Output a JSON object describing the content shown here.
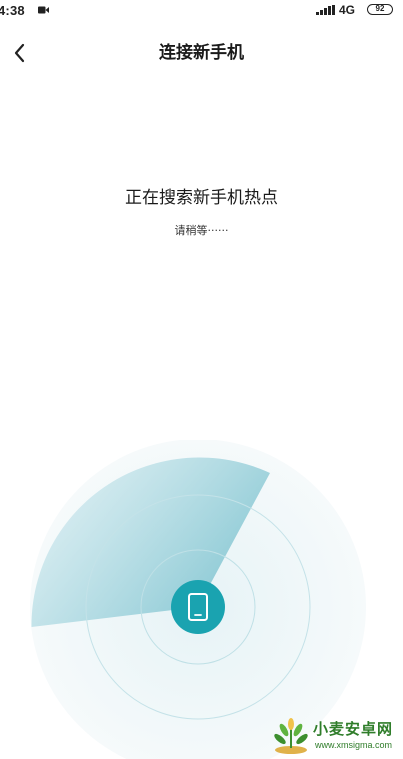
{
  "status_bar": {
    "time": "4:38",
    "network": "4G",
    "battery": "92",
    "icons": [
      "video-camera-icon",
      "signal-icon"
    ]
  },
  "header": {
    "back_icon": "chevron-left-icon",
    "title": "连接新手机"
  },
  "main": {
    "heading": "正在搜索新手机热点",
    "subtext": "请稍等······",
    "radar_center_icon": "phone-icon"
  },
  "colors": {
    "accent": "#1aa3b0",
    "radar_sweep": "#9fd3dd",
    "radar_bg": "#eef7f9"
  },
  "watermark": {
    "name": "小麦安卓网",
    "url": "www.xmsigma.com"
  }
}
